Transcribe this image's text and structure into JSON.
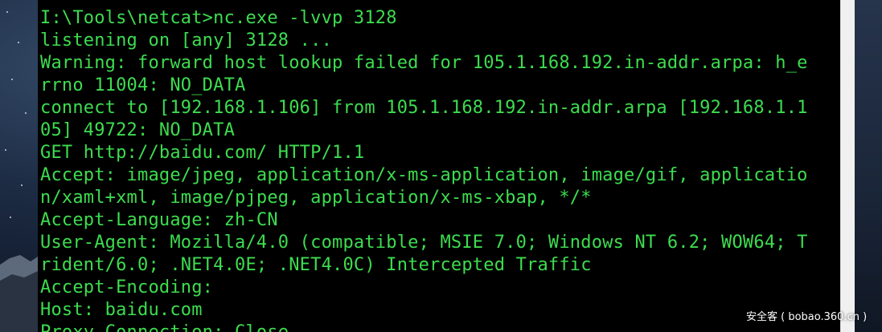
{
  "terminal": {
    "lines": [
      "I:\\Tools\\netcat>nc.exe -lvvp 3128",
      "listening on [any] 3128 ...",
      "Warning: forward host lookup failed for 105.1.168.192.in-addr.arpa: h_e",
      "rrno 11004: NO_DATA",
      "connect to [192.168.1.106] from 105.1.168.192.in-addr.arpa [192.168.1.1",
      "05] 49722: NO_DATA",
      "GET http://baidu.com/ HTTP/1.1",
      "Accept: image/jpeg, application/x-ms-application, image/gif, applicatio",
      "n/xaml+xml, image/pjpeg, application/x-ms-xbap, */*",
      "Accept-Language: zh-CN",
      "User-Agent: Mozilla/4.0 (compatible; MSIE 7.0; Windows NT 6.2; WOW64; T",
      "rident/6.0; .NET4.0E; .NET4.0C) Intercepted Traffic",
      "Accept-Encoding:",
      "Host: baidu.com",
      "Proxy-Connection: Close"
    ],
    "text_color": "#3ddc4f",
    "background_color": "#000000"
  },
  "watermark": {
    "text": "安全客 ( bobao.360.cn )"
  }
}
